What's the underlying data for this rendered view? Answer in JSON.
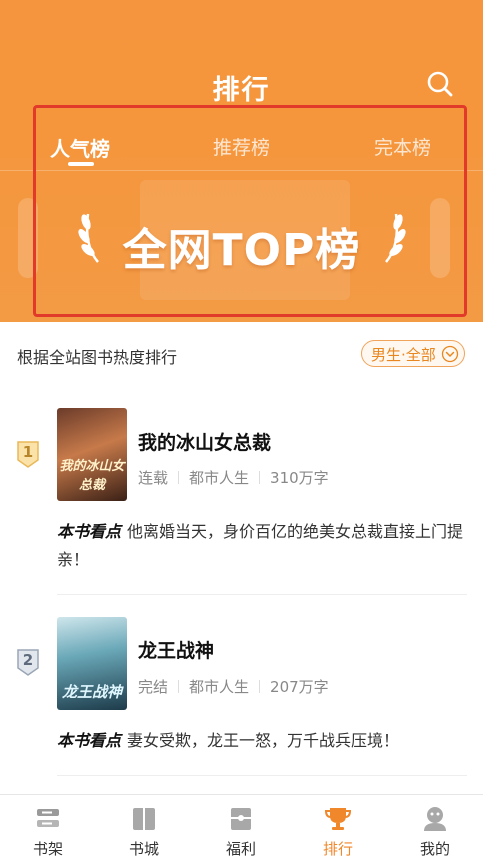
{
  "header": {
    "title": "排行",
    "tabs": [
      {
        "label": "人气榜",
        "active": true
      },
      {
        "label": "推荐榜",
        "active": false
      },
      {
        "label": "完本榜",
        "active": false
      }
    ],
    "banner_text": "全网TOP榜",
    "accent_color": "#f5953d"
  },
  "filter": {
    "description": "根据全站图书热度排行",
    "button_label": "男生·全部"
  },
  "books": [
    {
      "rank": "1",
      "title": "我的冰山女总裁",
      "status": "连载",
      "category": "都市人生",
      "word_count": "310万字",
      "highlight_label": "本书看点",
      "highlight_text": "他离婚当天，身价百亿的绝美女总裁直接上门提亲！",
      "cover_text": "我的冰山女总裁"
    },
    {
      "rank": "2",
      "title": "龙王战神",
      "status": "完结",
      "category": "都市人生",
      "word_count": "207万字",
      "highlight_label": "本书看点",
      "highlight_text": "妻女受欺，龙王一怒，万千战兵压境！",
      "cover_text": "龙王战神"
    }
  ],
  "tabbar": {
    "items": [
      {
        "label": "书架",
        "icon": "bookshelf-icon"
      },
      {
        "label": "书城",
        "icon": "book-icon"
      },
      {
        "label": "福利",
        "icon": "gift-icon"
      },
      {
        "label": "排行",
        "icon": "trophy-icon",
        "active": true
      },
      {
        "label": "我的",
        "icon": "profile-icon"
      }
    ]
  }
}
